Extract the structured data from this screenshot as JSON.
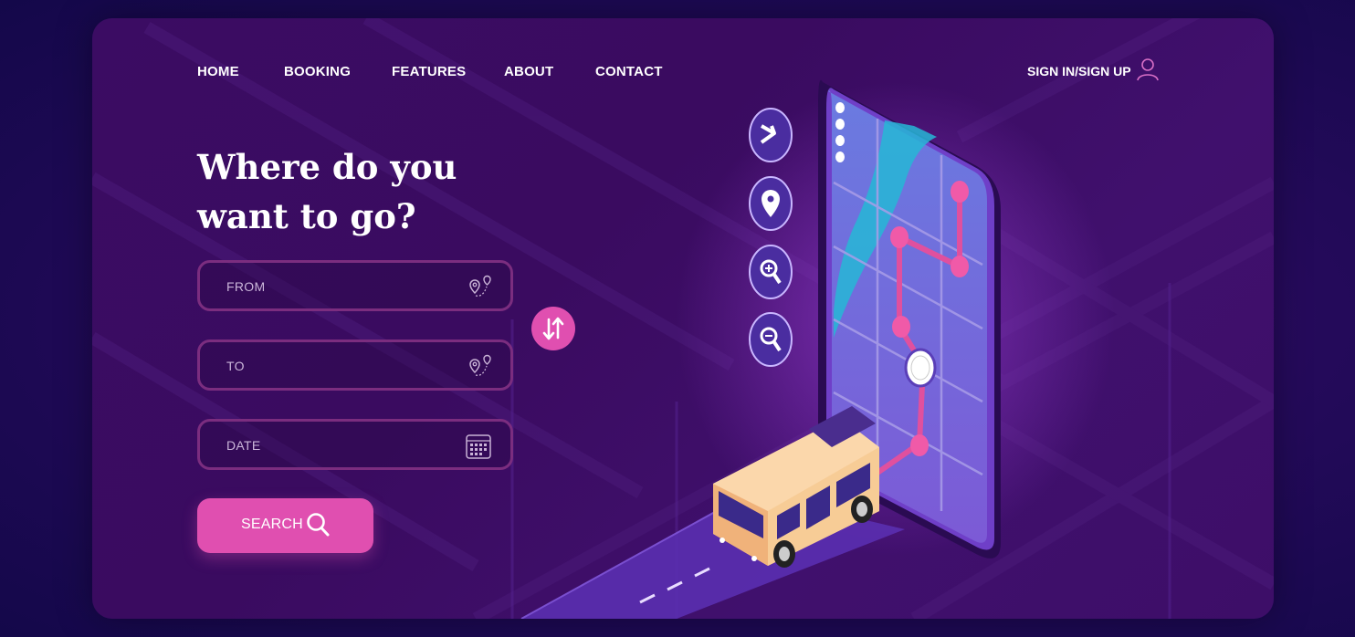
{
  "nav": {
    "items": [
      "HOME",
      "BOOKING",
      "FEATURES",
      "ABOUT",
      "CONTACT"
    ],
    "signin_label": "SIGN IN/SIGN UP"
  },
  "hero": {
    "headline_line1": "Where do you",
    "headline_line2": "want to go?"
  },
  "form": {
    "from_placeholder": "FROM",
    "to_placeholder": "TO",
    "date_placeholder": "DATE",
    "search_label": "SEARCH"
  },
  "icons": {
    "user": "user-icon",
    "route": "route-pin-icon",
    "calendar": "calendar-icon",
    "swap": "swap-arrows-icon",
    "search": "search-icon",
    "direction": "direction-arrow-icon",
    "location": "location-pin-icon",
    "zoom_in": "zoom-in-icon",
    "zoom_out": "zoom-out-icon"
  },
  "colors": {
    "accent": "#e04fb0",
    "field_border": "#7b2d7f",
    "background": "#3b0c63",
    "map_blue": "#5b6fd8",
    "bus": "#f5c08a"
  }
}
